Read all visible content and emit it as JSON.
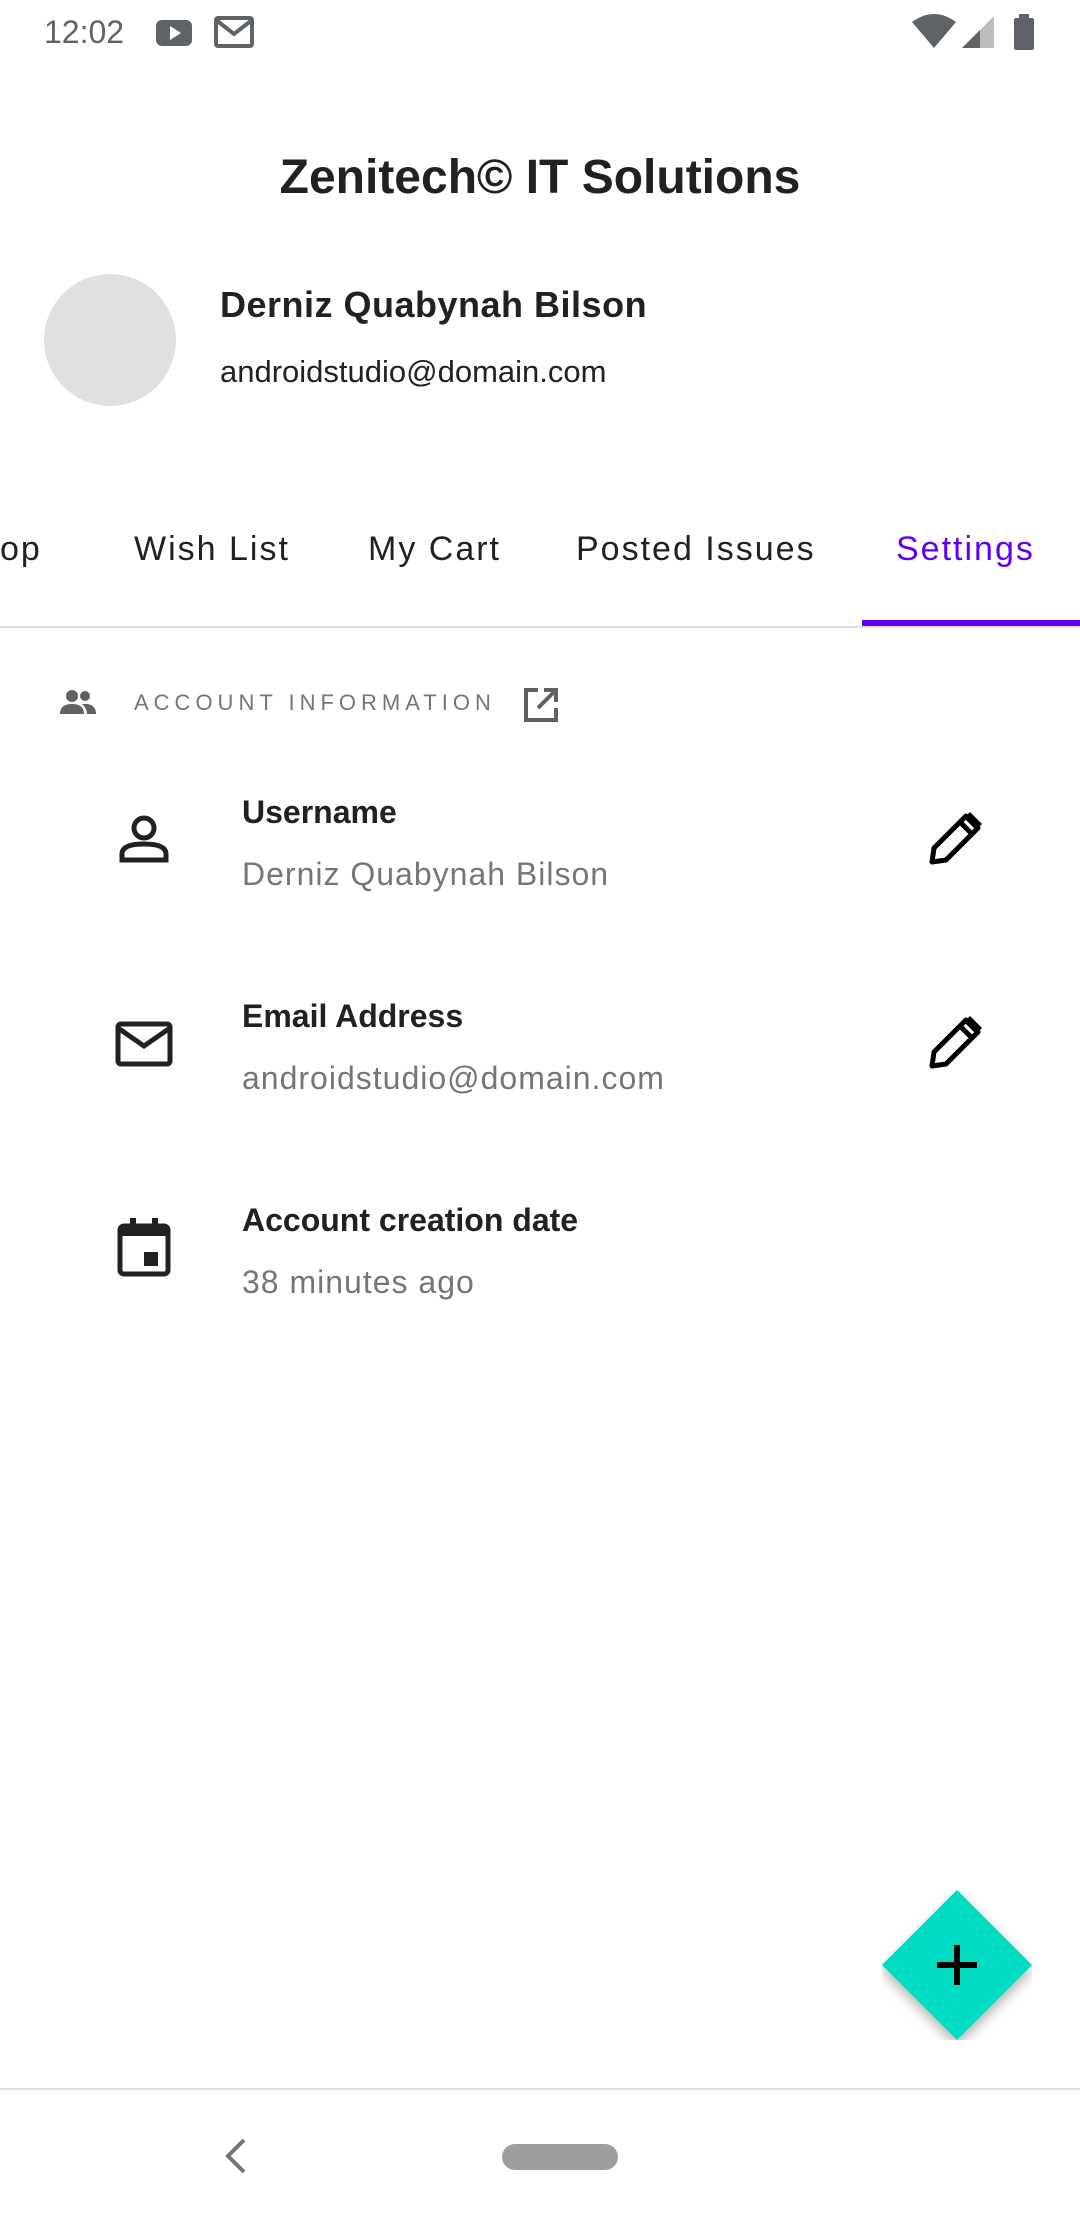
{
  "status_bar": {
    "time": "12:02",
    "icons_left": [
      "youtube-icon",
      "gmail-icon"
    ],
    "icons_right": [
      "wifi-icon",
      "signal-icon",
      "battery-icon"
    ]
  },
  "header": {
    "title": "Zenitech© IT Solutions",
    "user_name": "Derniz Quabynah Bilson",
    "user_email": "androidstudio@domain.com"
  },
  "tabs": [
    {
      "label": "op"
    },
    {
      "label": "Wish List"
    },
    {
      "label": "My Cart"
    },
    {
      "label": "Posted Issues"
    },
    {
      "label": "Settings",
      "active": true
    }
  ],
  "section": {
    "title": "ACCOUNT INFORMATION",
    "icon": "people-icon",
    "action_icon": "open-in-new-icon"
  },
  "rows": [
    {
      "label": "Username",
      "value": "Derniz Quabynah Bilson",
      "icon": "person-icon",
      "editable": true
    },
    {
      "label": "Email Address",
      "value": "androidstudio@domain.com",
      "icon": "mail-icon",
      "editable": true
    },
    {
      "label": "Account creation date",
      "value": "38 minutes ago",
      "icon": "calendar-icon",
      "editable": false
    }
  ],
  "colors": {
    "accent": "#6200ee",
    "fab": "#00dbc2",
    "secondary_text": "#757575"
  }
}
